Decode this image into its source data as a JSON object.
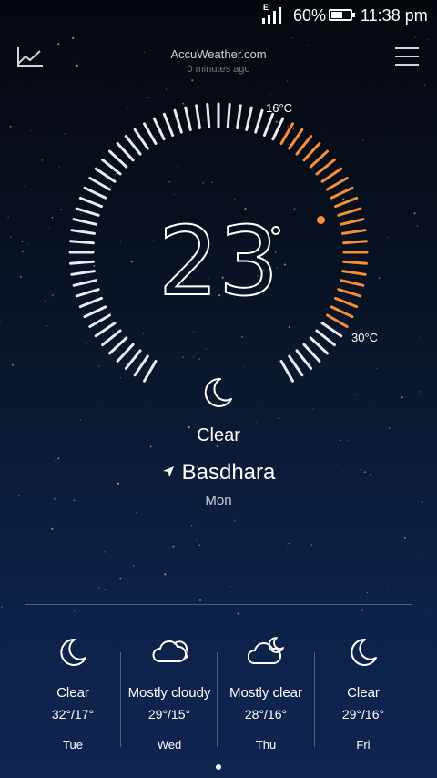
{
  "status_bar": {
    "network_type": "E",
    "battery_percent": "60%",
    "battery_level": 0.6,
    "time": "11:38 pm"
  },
  "header": {
    "source": "AccuWeather.com",
    "updated": "0 minutes ago",
    "chart_icon": "trend-chart-icon",
    "menu_icon": "hamburger-menu-icon"
  },
  "current": {
    "temperature": "23",
    "low": "16°C",
    "high": "30°C",
    "icon": "moon-icon",
    "condition": "Clear",
    "location": "Basdhara",
    "day": "Mon"
  },
  "forecast": [
    {
      "day": "Tue",
      "condition": "Clear",
      "temps": "32°/17°",
      "icon": "moon-icon"
    },
    {
      "day": "Wed",
      "condition": "Mostly cloudy",
      "temps": "29°/15°",
      "icon": "cloud-icon"
    },
    {
      "day": "Thu",
      "condition": "Mostly clear",
      "temps": "28°/16°",
      "icon": "cloud-moon-icon"
    },
    {
      "day": "Fri",
      "condition": "Clear",
      "temps": "29°/16°",
      "icon": "moon-icon"
    }
  ],
  "colors": {
    "accent": "#f4903a",
    "tick": "#e8ecf2",
    "background_top": "#05070d",
    "background_bottom": "#0e2550"
  }
}
